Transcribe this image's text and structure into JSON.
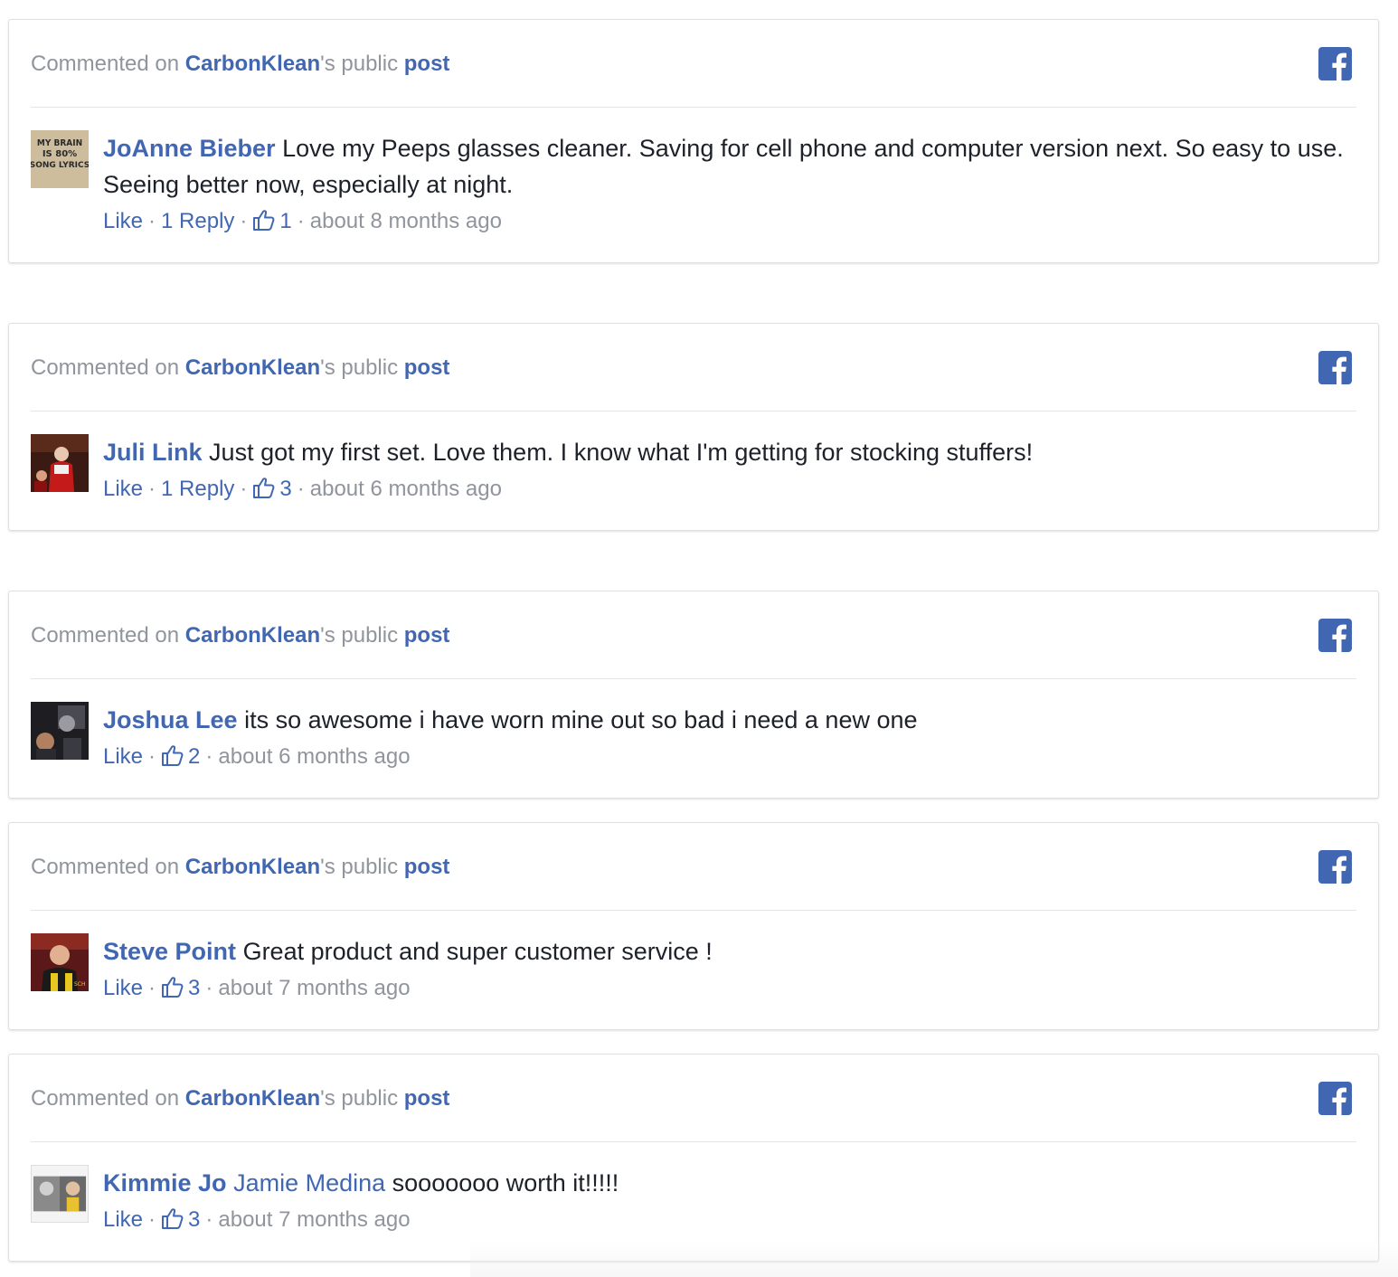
{
  "colors": {
    "link_blue": "#4267b2",
    "meta_gray": "#90949c",
    "text_dark": "#1d2129",
    "border": "#dddfe2"
  },
  "cards": [
    {
      "header": {
        "prefix": "Commented on",
        "page": "CarbonKlean",
        "suffix": "'s public",
        "post_link": "post"
      },
      "avatar": "avatar-text-image",
      "avatar_text": "MY BRAIN IS 80% SONG LYRICS",
      "author": "JoAnne Bieber",
      "mention": "",
      "text": "Love my Peeps glasses cleaner. Saving for cell phone and computer version next. So easy to use. Seeing better now, especially at night.",
      "like_label": "Like",
      "reply_label": "1 Reply",
      "likes": "1",
      "time": "about 8 months ago"
    },
    {
      "header": {
        "prefix": "Commented on",
        "page": "CarbonKlean",
        "suffix": "'s public",
        "post_link": "post"
      },
      "avatar": "avatar-photo",
      "author": "Juli Link",
      "mention": "",
      "text": "Just got my first set. Love them. I know what I'm getting for stocking stuffers!",
      "like_label": "Like",
      "reply_label": "1 Reply",
      "likes": "3",
      "time": "about 6 months ago"
    },
    {
      "header": {
        "prefix": "Commented on",
        "page": "CarbonKlean",
        "suffix": "'s public",
        "post_link": "post"
      },
      "avatar": "avatar-photo",
      "author": "Joshua Lee",
      "mention": "",
      "text": "its so awesome i have worn mine out so bad i need a new one",
      "like_label": "Like",
      "reply_label": "",
      "likes": "2",
      "time": "about 6 months ago"
    },
    {
      "header": {
        "prefix": "Commented on",
        "page": "CarbonKlean",
        "suffix": "'s public",
        "post_link": "post"
      },
      "avatar": "avatar-photo",
      "author": "Steve Point",
      "mention": "",
      "text": "Great product and super customer service !",
      "like_label": "Like",
      "reply_label": "",
      "likes": "3",
      "time": "about 7 months ago"
    },
    {
      "header": {
        "prefix": "Commented on",
        "page": "CarbonKlean",
        "suffix": "'s public",
        "post_link": "post"
      },
      "avatar": "avatar-photo",
      "author": "Kimmie Jo",
      "mention": "Jamie Medina",
      "text": "sooooooo worth it!!!!!",
      "like_label": "Like",
      "reply_label": "",
      "likes": "3",
      "time": "about 7 months ago"
    }
  ]
}
